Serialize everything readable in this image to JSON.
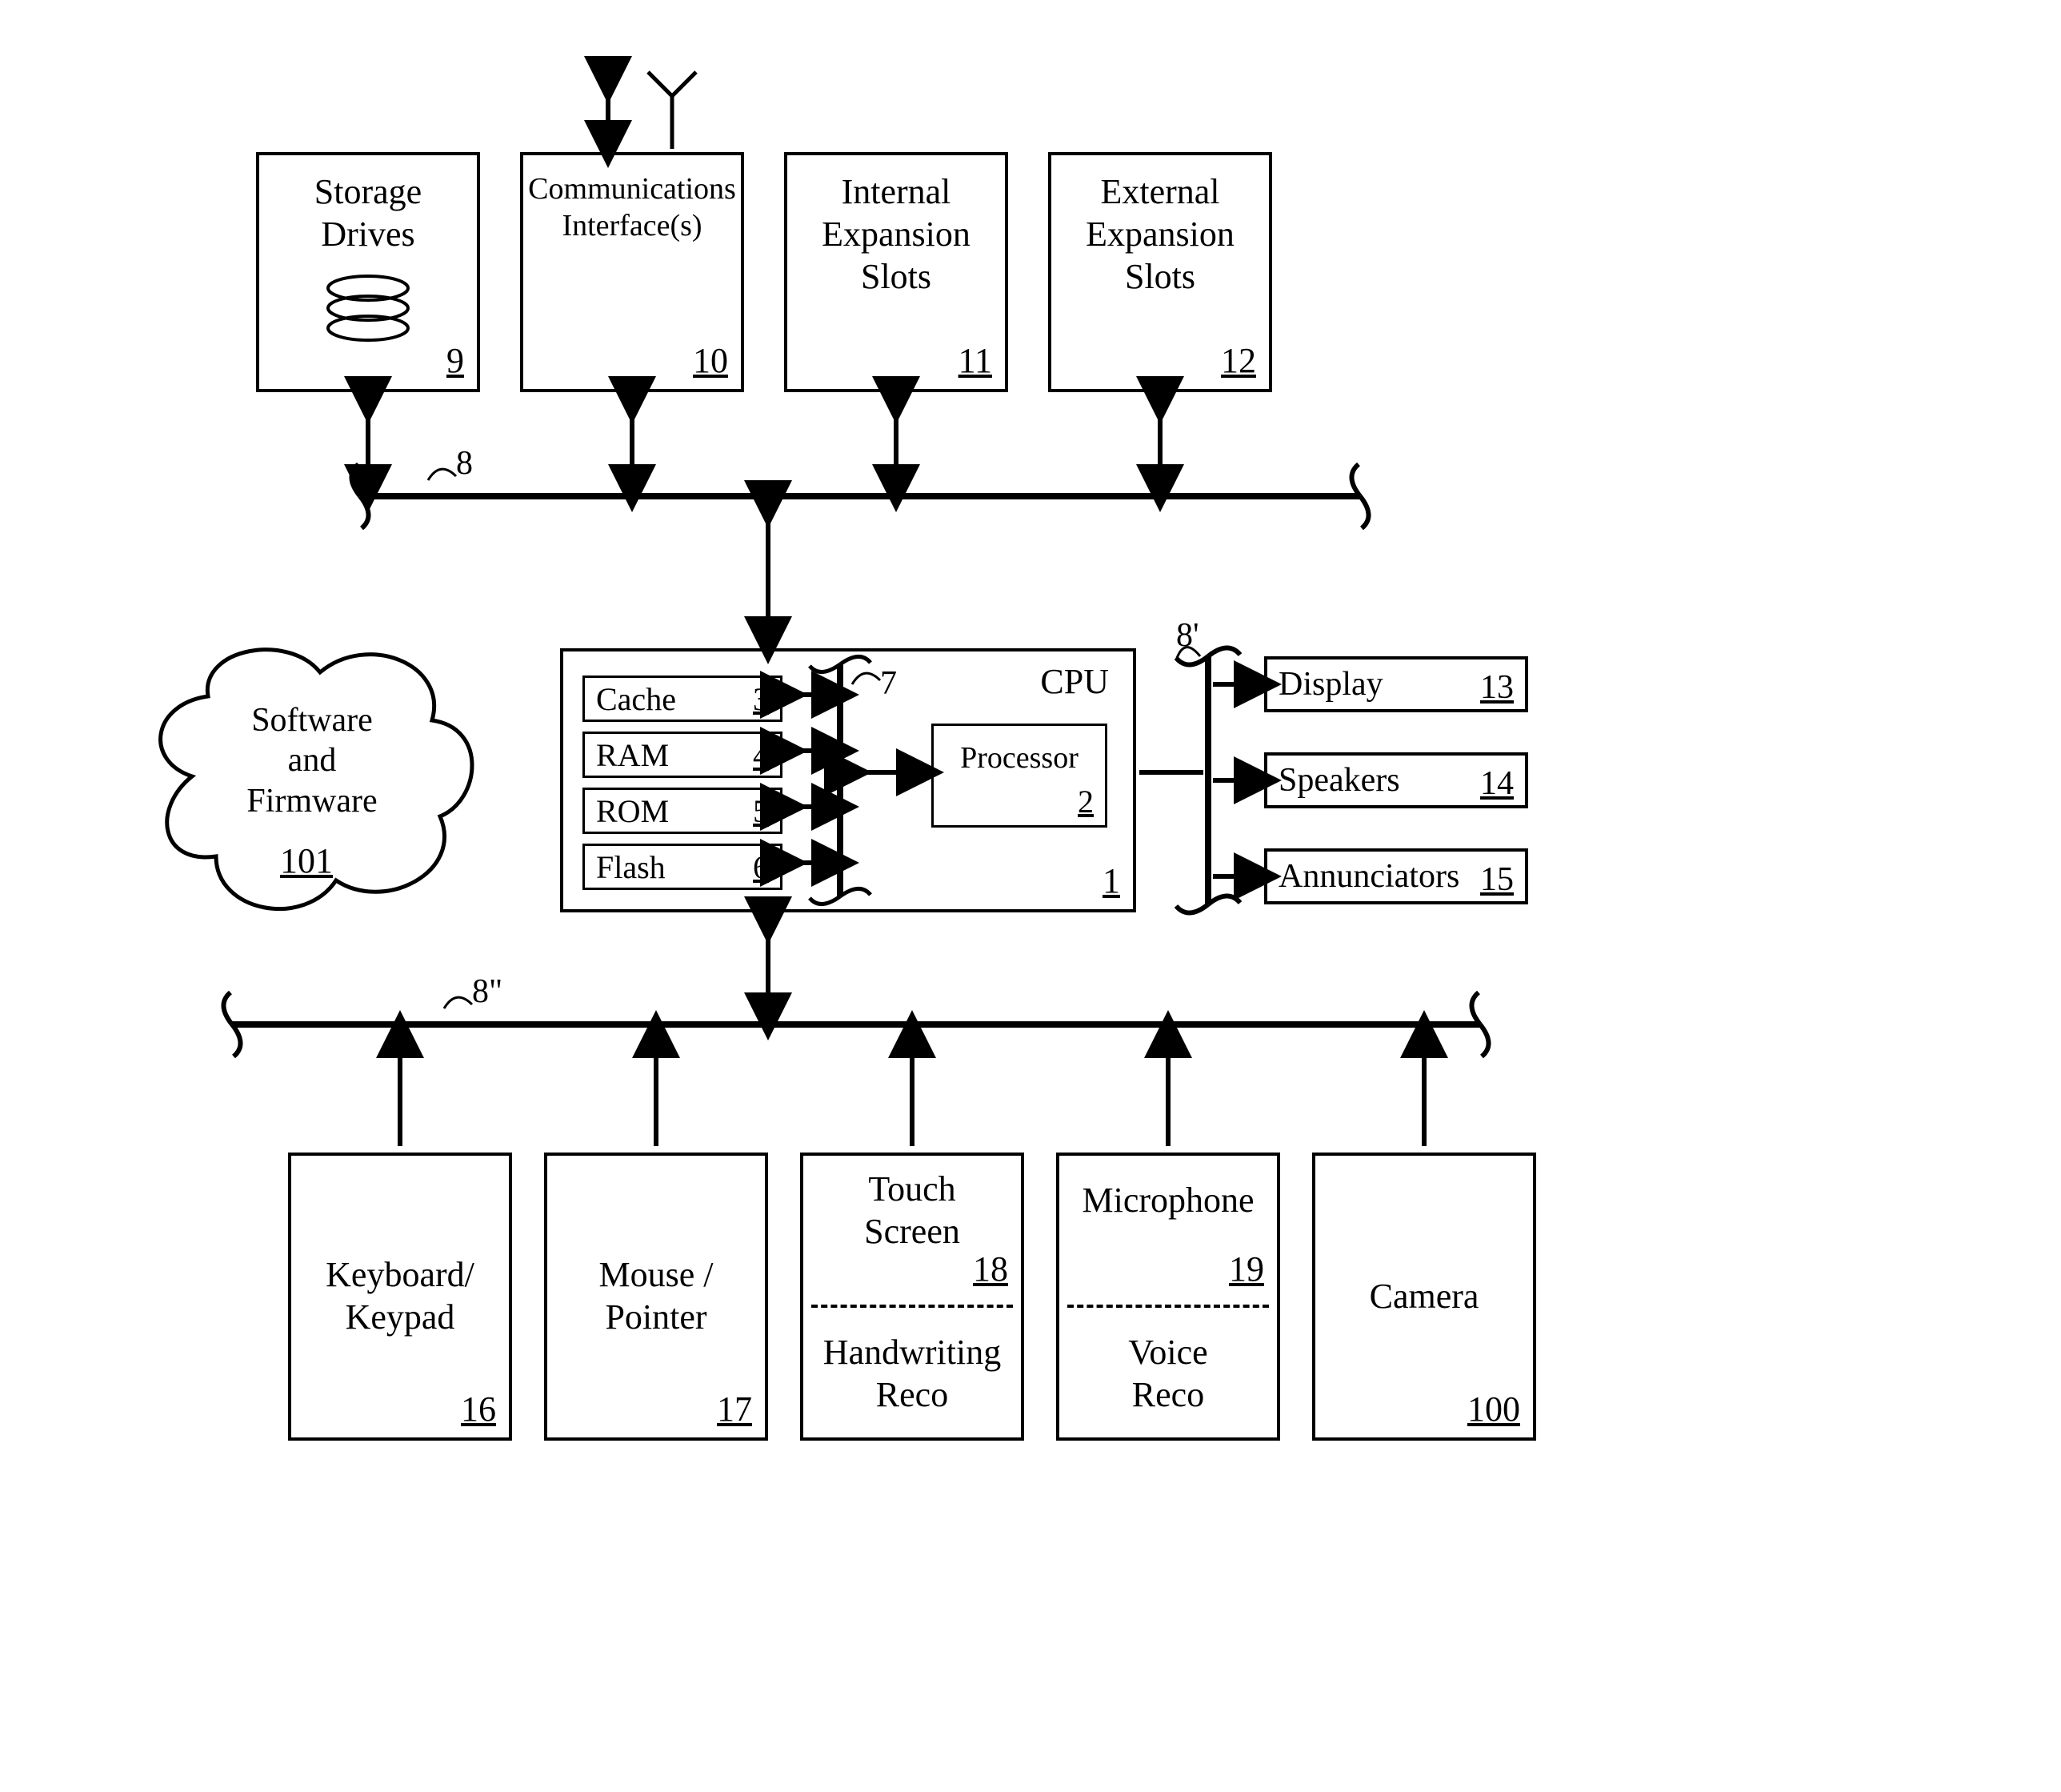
{
  "topRow": {
    "storage": {
      "label1": "Storage",
      "label2": "Drives",
      "ref": "9"
    },
    "comm": {
      "label1": "Communications",
      "label2": "Interface(s)",
      "ref": "10"
    },
    "intExp": {
      "label1": "Internal",
      "label2": "Expansion",
      "label3": "Slots",
      "ref": "11"
    },
    "extExp": {
      "label1": "External",
      "label2": "Expansion",
      "label3": "Slots",
      "ref": "12"
    }
  },
  "cpu": {
    "label": "CPU",
    "ref": "1",
    "cache": {
      "label": "Cache",
      "ref": "3"
    },
    "ram": {
      "label": "RAM",
      "ref": "4"
    },
    "rom": {
      "label": "ROM",
      "ref": "5"
    },
    "flash": {
      "label": "Flash",
      "ref": "6"
    },
    "processor": {
      "label": "Processor",
      "ref": "2"
    }
  },
  "outputs": {
    "display": {
      "label": "Display",
      "ref": "13"
    },
    "speakers": {
      "label": "Speakers",
      "ref": "14"
    },
    "annunciators": {
      "label": "Annunciators",
      "ref": "15"
    }
  },
  "bottomRow": {
    "keyboard": {
      "label1": "Keyboard/",
      "label2": "Keypad",
      "ref": "16"
    },
    "mouse": {
      "label1": "Mouse /",
      "label2": "Pointer",
      "ref": "17"
    },
    "touch": {
      "label1": "Touch",
      "label2": "Screen",
      "ref": "18",
      "sub1": "Handwriting",
      "sub2": "Reco"
    },
    "mic": {
      "label1": "Microphone",
      "ref": "19",
      "sub1": "Voice",
      "sub2": "Reco"
    },
    "camera": {
      "label1": "Camera",
      "ref": "100"
    }
  },
  "cloud": {
    "label1": "Software",
    "label2": "and",
    "label3": "Firmware",
    "ref": "101"
  },
  "busLabels": {
    "top": "8",
    "cpuInternal": "7",
    "right": "8'",
    "bottom": "8\""
  }
}
